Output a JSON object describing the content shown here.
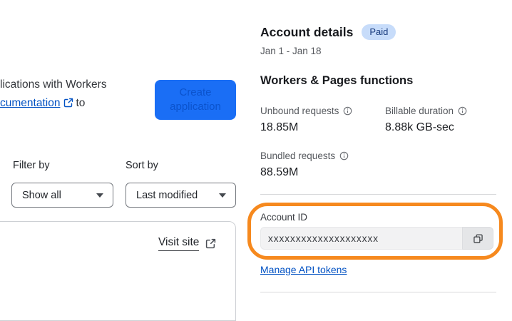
{
  "colors": {
    "accent_blue": "#1A6EF5",
    "button_text_blue": "#0B53CD",
    "link_blue": "#0051C3",
    "badge_bg": "#C7DCFA",
    "badge_text": "#16397C",
    "annotation_orange": "#F6891E",
    "input_bg": "#F2F2F3",
    "copy_btn_bg": "#E5E6E8",
    "divider": "#D8D9DB",
    "border_gray": "#75797F",
    "card_border": "#CDD0D4",
    "text_dark": "#1D1F23",
    "text_gray": "#55585D"
  },
  "left": {
    "intro_line1": "lications with Workers",
    "intro_link": "cumentation",
    "intro_after_link": "to",
    "create_button": "Create application",
    "filter_by_label": "Filter by",
    "filter_value": "Show all",
    "sort_by_label": "Sort by",
    "sort_value": "Last modified",
    "visit_site": "Visit site"
  },
  "account": {
    "title": "Account details",
    "badge": "Paid",
    "date_range": "Jan 1 - Jan 18",
    "section_title": "Workers & Pages functions",
    "metrics": [
      {
        "label": "Unbound requests",
        "value": "18.85M"
      },
      {
        "label": "Billable duration",
        "value": "8.88k GB-sec"
      },
      {
        "label": "Bundled requests",
        "value": "88.59M"
      }
    ],
    "account_id_label": "Account ID",
    "account_id_value": "xxxxxxxxxxxxxxxxxxxx",
    "manage_link": "Manage API tokens"
  }
}
